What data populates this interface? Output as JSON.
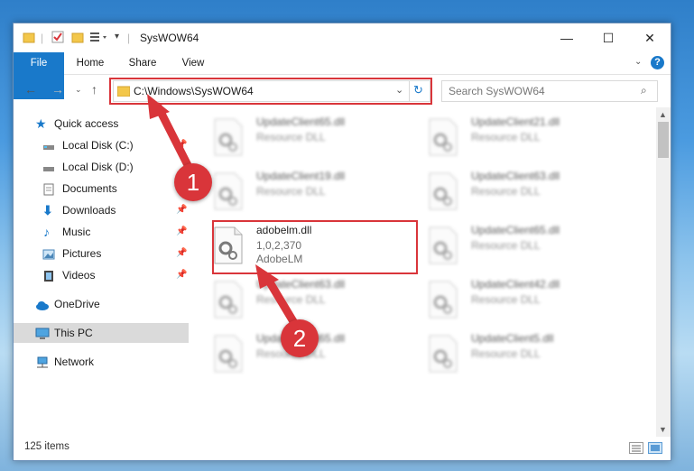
{
  "window": {
    "title": "SysWOW64"
  },
  "ribbon": {
    "tabs": [
      "File",
      "Home",
      "Share",
      "View"
    ]
  },
  "address": {
    "path": "C:\\Windows\\SysWOW64"
  },
  "search": {
    "placeholder": "Search SysWOW64"
  },
  "nav": {
    "items": [
      {
        "label": "Quick access",
        "icon": "star-icon"
      },
      {
        "label": "Local Disk (C:)",
        "icon": "drive-icon"
      },
      {
        "label": "Local Disk (D:)",
        "icon": "drive-icon"
      },
      {
        "label": "Documents",
        "icon": "documents-icon"
      },
      {
        "label": "Downloads",
        "icon": "download-icon"
      },
      {
        "label": "Music",
        "icon": "music-icon"
      },
      {
        "label": "Pictures",
        "icon": "pictures-icon"
      },
      {
        "label": "Videos",
        "icon": "videos-icon"
      },
      {
        "label": "OneDrive",
        "icon": "cloud-icon"
      },
      {
        "label": "This PC",
        "icon": "computer-icon"
      },
      {
        "label": "Network",
        "icon": "network-icon"
      }
    ]
  },
  "files": [
    {
      "name": "UpdateClient65.dll",
      "line2": "Resource DLL"
    },
    {
      "name": "UpdateClient21.dll",
      "line2": "Resource DLL"
    },
    {
      "name": "UpdateClient19.dll",
      "line2": "Resource DLL"
    },
    {
      "name": "UpdateClient63.dll",
      "line2": "Resource DLL"
    },
    {
      "name": "adobelm.dll",
      "line2": "1,0,2,370",
      "line3": "AdobeLM"
    },
    {
      "name": "UpdateClient65.dll",
      "line2": "Resource DLL"
    },
    {
      "name": "UpdateClient63.dll",
      "line2": "Resource DLL"
    },
    {
      "name": "UpdateClient42.dll",
      "line2": "Resource DLL"
    },
    {
      "name": "UpdateClient65.dll",
      "line2": "Resource DLL"
    },
    {
      "name": "UpdateClient5.dll",
      "line2": "Resource DLL"
    }
  ],
  "status": {
    "count": "125 items"
  },
  "callouts": {
    "one": "1",
    "two": "2"
  },
  "colors": {
    "accent": "#1979ca",
    "highlight": "#d9353a"
  }
}
